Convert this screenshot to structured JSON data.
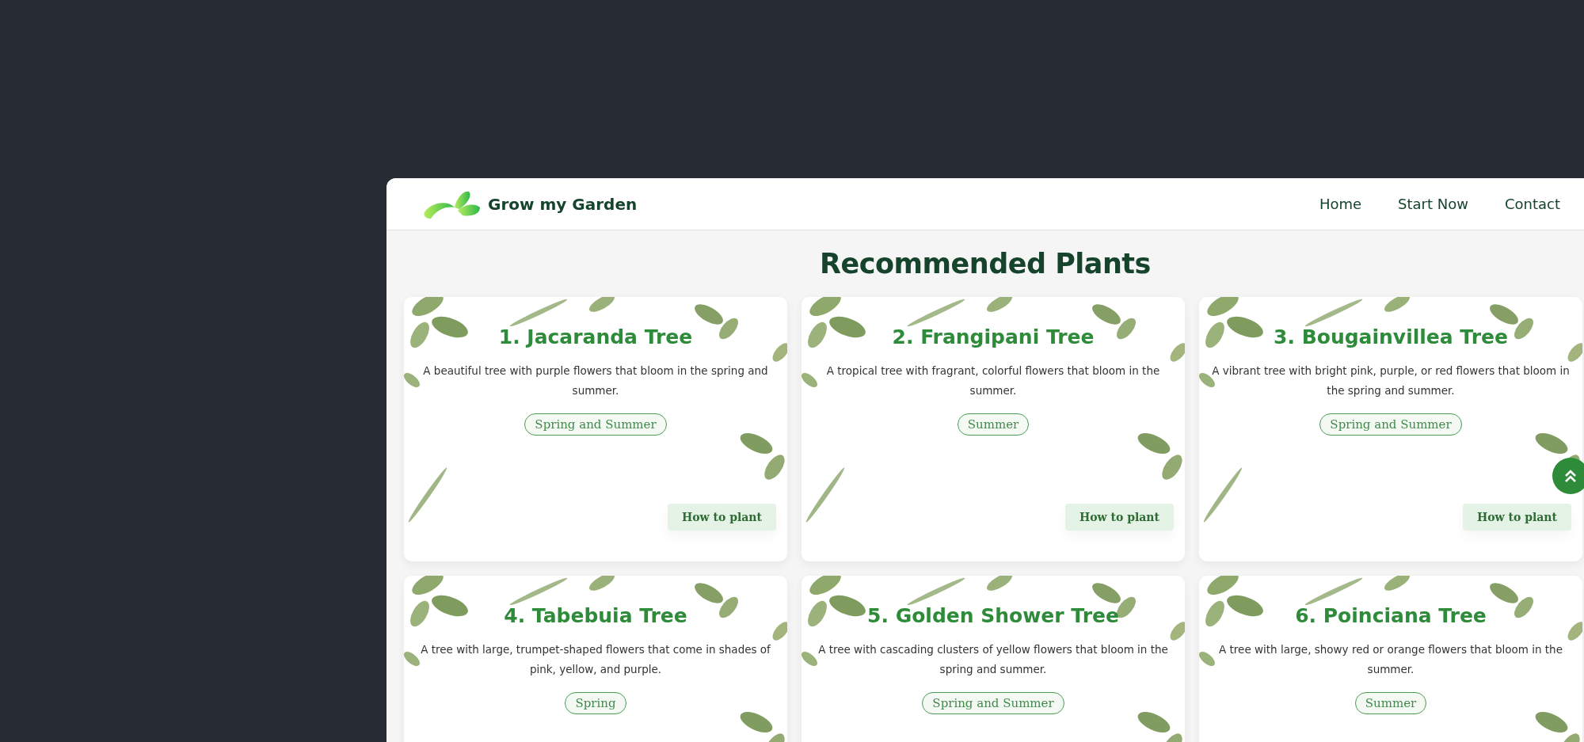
{
  "header": {
    "brand": "Grow my Garden",
    "nav": [
      {
        "label": "Home"
      },
      {
        "label": "Start Now"
      },
      {
        "label": "Contact"
      }
    ]
  },
  "title": "Recommended Plants",
  "plants": [
    {
      "name": "1. Jacaranda Tree",
      "description": "A beautiful tree with purple flowers that bloom in the spring and summer.",
      "season": "Spring and Summer",
      "button": "How to plant"
    },
    {
      "name": "2. Frangipani Tree",
      "description": "A tropical tree with fragrant, colorful flowers that bloom in the summer.",
      "season": "Summer",
      "button": "How to plant"
    },
    {
      "name": "3. Bougainvillea Tree",
      "description": "A vibrant tree with bright pink, purple, or red flowers that bloom in the spring and summer.",
      "season": "Spring and Summer",
      "button": "How to plant"
    },
    {
      "name": "4. Tabebuia Tree",
      "description": "A tree with large, trumpet-shaped flowers that come in shades of pink, yellow, and purple.",
      "season": "Spring"
    },
    {
      "name": "5. Golden Shower Tree",
      "description": "A tree with cascading clusters of yellow flowers that bloom in the spring and summer.",
      "season": "Spring and Summer"
    },
    {
      "name": "6. Poinciana Tree",
      "description": "A tree with large, showy red or orange flowers that bloom in the summer.",
      "season": "Summer"
    }
  ]
}
